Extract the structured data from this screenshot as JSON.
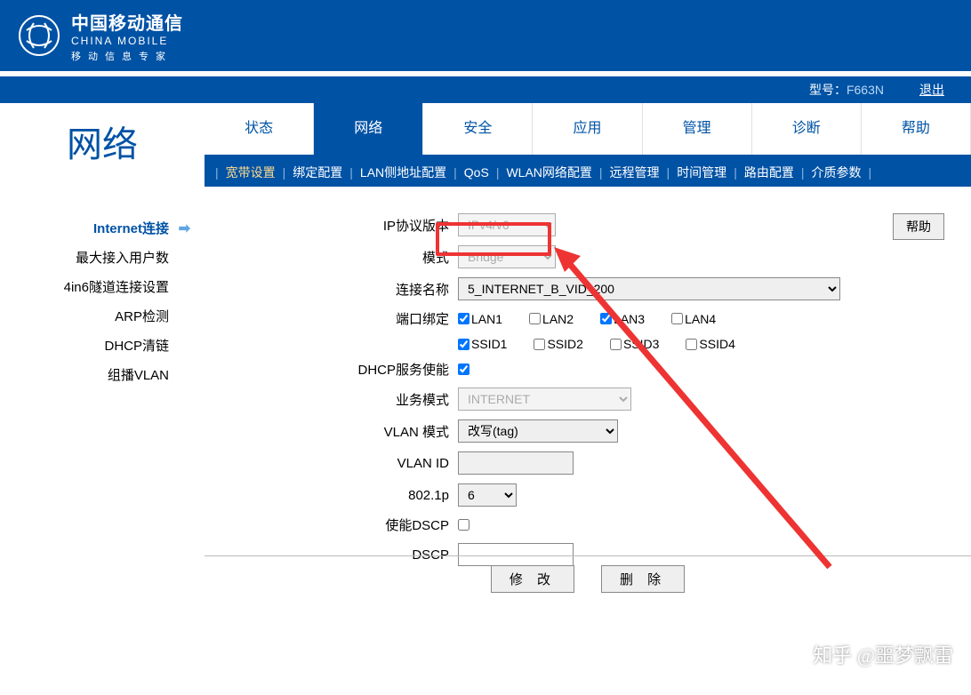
{
  "header": {
    "brand_cn": "中国移动通信",
    "brand_en": "CHINA MOBILE",
    "slogan": "移动信息专家",
    "model_label": "型号：",
    "model_value": "F663N",
    "logout": "退出"
  },
  "page_title": "网络",
  "tabs": [
    "状态",
    "网络",
    "安全",
    "应用",
    "管理",
    "诊断",
    "帮助"
  ],
  "active_tab": "网络",
  "subnav": [
    "宽带设置",
    "绑定配置",
    "LAN侧地址配置",
    "QoS",
    "WLAN网络配置",
    "远程管理",
    "时间管理",
    "路由配置",
    "介质参数"
  ],
  "active_subnav": "宽带设置",
  "side_menu": [
    "Internet连接",
    "最大接入用户数",
    "4in6隧道连接设置",
    "ARP检测",
    "DHCP清链",
    "组播VLAN"
  ],
  "active_side": "Internet连接",
  "help_button": "帮助",
  "form": {
    "ip_ver_label": "IP协议版本",
    "ip_ver_value": "IPv4/v6",
    "mode_label": "模式",
    "mode_value": "Bridge",
    "conn_name_label": "连接名称",
    "conn_name_value": "5_INTERNET_B_VID_200",
    "port_bind_label": "端口绑定",
    "ports_row1": [
      {
        "label": "LAN1",
        "checked": true
      },
      {
        "label": "LAN2",
        "checked": false
      },
      {
        "label": "LAN3",
        "checked": true
      },
      {
        "label": "LAN4",
        "checked": false
      }
    ],
    "ports_row2": [
      {
        "label": "SSID1",
        "checked": true
      },
      {
        "label": "SSID2",
        "checked": false
      },
      {
        "label": "SSID3",
        "checked": false
      },
      {
        "label": "SSID4",
        "checked": false
      }
    ],
    "dhcp_enable_label": "DHCP服务使能",
    "dhcp_enable_checked": true,
    "svc_mode_label": "业务模式",
    "svc_mode_value": "INTERNET",
    "vlan_mode_label": "VLAN 模式",
    "vlan_mode_value": "改写(tag)",
    "vlan_id_label": "VLAN ID",
    "vlan_id_value": "",
    "p8021_label": "802.1p",
    "p8021_value": "6",
    "enable_dscp_label": "使能DSCP",
    "enable_dscp_checked": false,
    "dscp_label": "DSCP",
    "dscp_value": ""
  },
  "buttons": {
    "modify": "修 改",
    "delete": "删 除"
  },
  "watermark": "知乎 @噩梦飘雷"
}
